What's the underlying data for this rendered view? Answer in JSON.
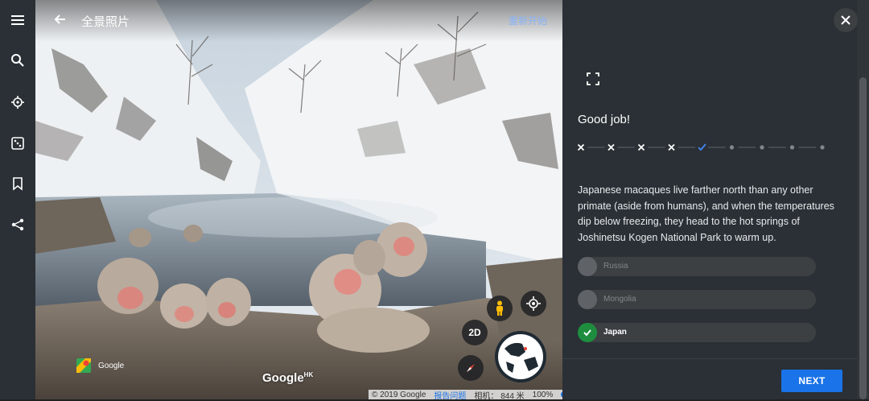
{
  "header": {
    "title": "全景照片",
    "restart_label": "重新开始"
  },
  "rail": {
    "items": [
      {
        "name": "menu-icon"
      },
      {
        "name": "search-icon"
      },
      {
        "name": "voyager-icon"
      },
      {
        "name": "dice-icon"
      },
      {
        "name": "bookmark-icon"
      },
      {
        "name": "share-icon"
      }
    ]
  },
  "pano": {
    "brand_text": "Google",
    "watermark": "Google",
    "watermark_region": "HK",
    "toggle_label": "2D",
    "footer": {
      "copyright": "© 2019 Google",
      "report": "报告问题",
      "camera": "相机：  844 米",
      "zoom": "100%"
    }
  },
  "quiz": {
    "heading": "Good job!",
    "progress": [
      "wrong",
      "wrong",
      "wrong",
      "wrong",
      "correct",
      "pending",
      "pending",
      "pending",
      "pending"
    ],
    "description": "Japanese macaques live farther north than any other primate (aside from humans), and when the temperatures dip below freezing, they head to the hot springs of Joshinetsu Kogen National Park to warm up.",
    "options": [
      {
        "label": "Russia",
        "selected": false
      },
      {
        "label": "Mongolia",
        "selected": false
      },
      {
        "label": "Japan",
        "selected": true
      }
    ],
    "next_label": "NEXT"
  },
  "colors": {
    "panel_bg": "#2a3035",
    "accent_blue": "#1a73e8",
    "correct_green": "#1e8e3e",
    "check_blue": "#4285f4"
  }
}
